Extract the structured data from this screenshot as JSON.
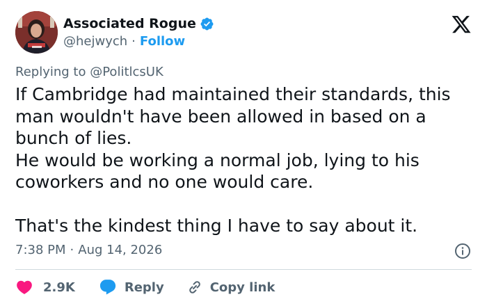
{
  "author": {
    "display_name": "Associated Rogue",
    "handle": "@hejwych",
    "separator": "·",
    "follow_label": "Follow",
    "verified": true
  },
  "reply_context": {
    "prefix": "Replying to",
    "mention": "@PolitlcsUK"
  },
  "tweet": {
    "lines": [
      "If Cambridge had maintained their standards, this",
      "man wouldn't have been allowed in based on a",
      "bunch of lies.",
      "He would be working a normal job, lying to his",
      "coworkers and no one would care.",
      "",
      "That's the kindest thing I have to say about it."
    ]
  },
  "meta": {
    "time": "7:38 PM",
    "separator": "·",
    "date": "Aug 14, 2026"
  },
  "actions": {
    "like_count": "2.9K",
    "reply_label": "Reply",
    "copy_link_label": "Copy link"
  },
  "colors": {
    "text": "#0f1419",
    "secondary": "#536471",
    "accent": "#1d9bf0",
    "like": "#f91880",
    "divider": "#cfd9de"
  },
  "icons": {
    "verified": "verified-badge-icon",
    "brand": "x-logo-icon",
    "info": "info-icon",
    "like": "heart-icon",
    "reply": "speech-bubble-icon",
    "copy_link": "link-icon"
  }
}
